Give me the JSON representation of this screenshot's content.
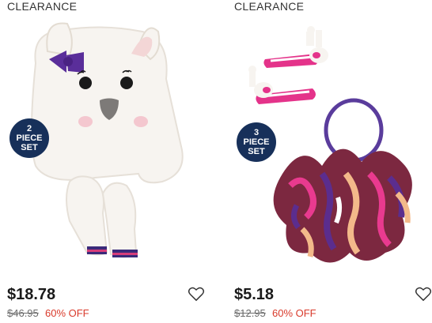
{
  "products": [
    {
      "tag": "CLEARANCE",
      "badge": [
        "2",
        "PIECE",
        "SET"
      ],
      "price": "$18.78",
      "original_price": "$46.95",
      "discount": "60% OFF",
      "image_icon": "llama-hat-and-mittens-image",
      "favorite_icon": "heart-outline-icon"
    },
    {
      "tag": "CLEARANCE",
      "badge": [
        "3",
        "PIECE",
        "SET"
      ],
      "price": "$5.18",
      "original_price": "$12.95",
      "discount": "60% OFF",
      "image_icon": "llama-hair-clips-and-ribbon-image",
      "favorite_icon": "heart-outline-icon"
    }
  ],
  "colors": {
    "badge_bg": "#17305a",
    "discount": "#d93a2b",
    "price": "#1a1a1a"
  }
}
